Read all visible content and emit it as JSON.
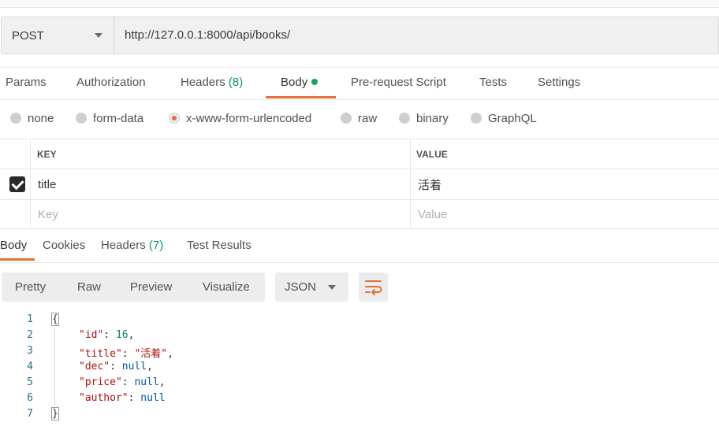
{
  "request": {
    "method": "POST",
    "url": "http://127.0.0.1:8000/api/books/"
  },
  "tabs": [
    {
      "label": "Params"
    },
    {
      "label": "Authorization"
    },
    {
      "label": "Headers",
      "count": "(8)"
    },
    {
      "label": "Body"
    },
    {
      "label": "Pre-request Script"
    },
    {
      "label": "Tests"
    },
    {
      "label": "Settings"
    }
  ],
  "body_types": [
    "none",
    "form-data",
    "x-www-form-urlencoded",
    "raw",
    "binary",
    "GraphQL"
  ],
  "selected_body_type": "x-www-form-urlencoded",
  "kv_table": {
    "headers": {
      "key": "KEY",
      "value": "VALUE"
    },
    "rows": [
      {
        "key": "title",
        "value": "活着",
        "checked": true
      }
    ],
    "placeholder": {
      "key": "Key",
      "value": "Value"
    }
  },
  "response_tabs": [
    {
      "label": "Body"
    },
    {
      "label": "Cookies"
    },
    {
      "label": "Headers",
      "count": "(7)"
    },
    {
      "label": "Test Results"
    }
  ],
  "view_modes": [
    "Pretty",
    "Raw",
    "Preview",
    "Visualize"
  ],
  "format": "JSON",
  "code": {
    "line_numbers": [
      "1",
      "2",
      "3",
      "4",
      "5",
      "6",
      "7"
    ],
    "lines": [
      "{",
      "\"id\": 16,",
      "\"title\": \"活着\",",
      "\"dec\": null,",
      "\"price\": null,",
      "\"author\": null",
      "}"
    ]
  },
  "colors": {
    "accent": "#e1703a",
    "dot": "#1aa35b",
    "count": "#0a9a5a"
  }
}
